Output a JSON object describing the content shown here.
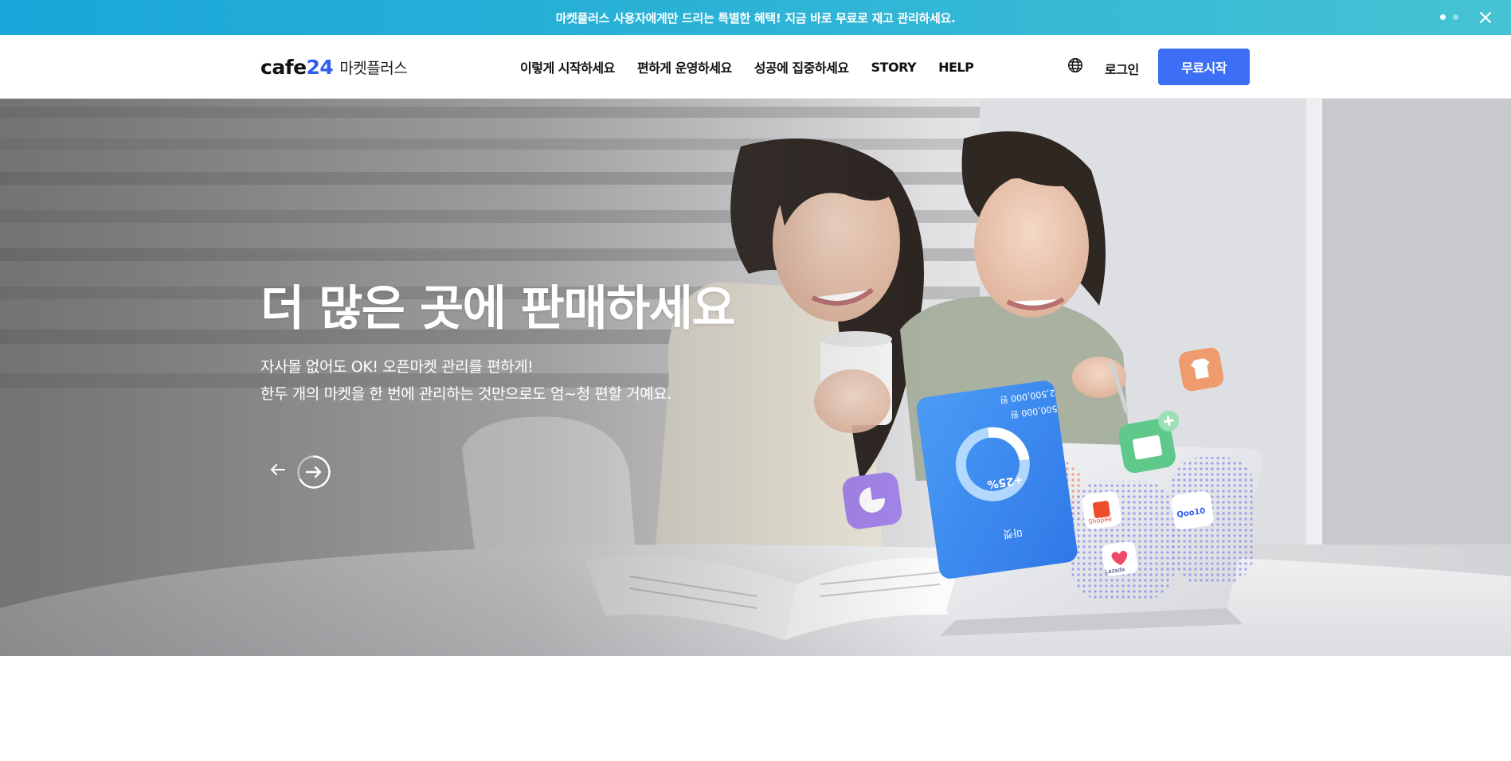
{
  "promo": {
    "text": "마켓플러스 사용자에게만 드리는 특별한 혜택! 지금 바로 무료로 재고 관리하세요.",
    "slides_total": 2,
    "active_slide": 1
  },
  "header": {
    "logo_brand_main": "cafe",
    "logo_brand_num": "24",
    "logo_product": "마켓플러스",
    "nav": [
      {
        "label": "이렇게 시작하세요"
      },
      {
        "label": "편하게 운영하세요"
      },
      {
        "label": "성공에 집중하세요"
      },
      {
        "label": "STORY"
      },
      {
        "label": "HELP"
      }
    ],
    "login_label": "로그인",
    "cta_label": "무료시작"
  },
  "hero": {
    "title": "더 많은 곳에 판매하세요",
    "desc_line1": "자사몰 없어도 OK! 오픈마켓 관리를 편하게!",
    "desc_line2": "한두 개의 마켓을 한 번에 관리하는 것만으로도 엄~청 편할 거예요.",
    "tablet": {
      "label": "마켓",
      "growth": "+25%",
      "value1": "500,000 원",
      "value2": "2,500,000 원"
    },
    "market_badges": [
      "Shopee",
      "Qoo10",
      "Lazada"
    ]
  },
  "colors": {
    "promo_start": "#19a6d8",
    "promo_end": "#45c3d4",
    "brand_blue": "#3c6ef6",
    "logo_24": "#2f5df0"
  }
}
